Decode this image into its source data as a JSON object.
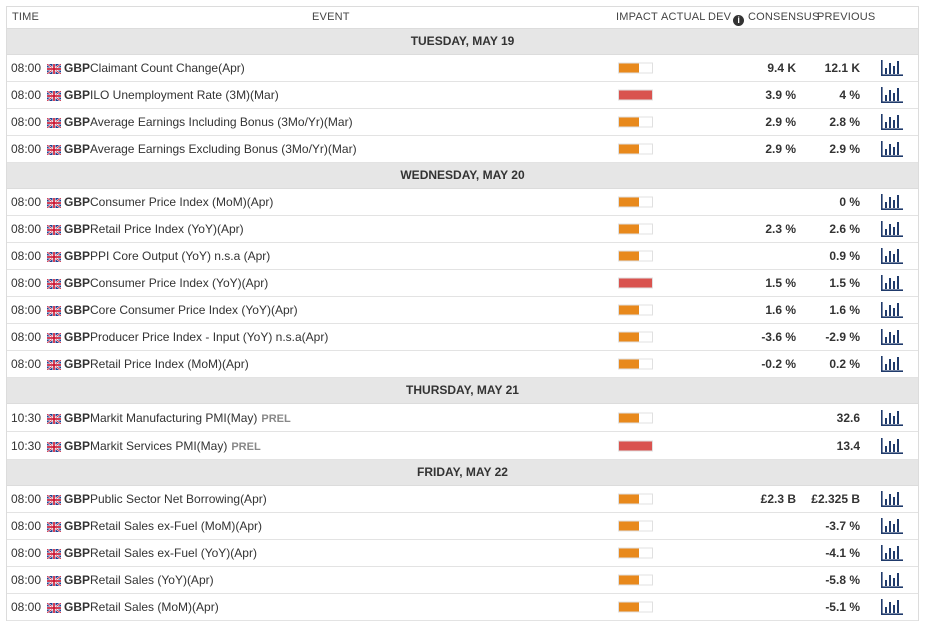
{
  "header": {
    "time": "Time",
    "event": "Event",
    "impact": "Impact",
    "actual": "Actual",
    "dev": "Dev",
    "consensus": "Consensus",
    "previous": "Previous"
  },
  "colors": {
    "medium": "#e8891c",
    "high": "#d9534f",
    "chart_icon": "#1f3a6b"
  },
  "days": [
    {
      "label": "Tuesday, May 19",
      "events": [
        {
          "time": "08:00",
          "currency": "GBP",
          "name": "Claimant Count Change(Apr)",
          "impact": "medium",
          "consensus": "9.4 K",
          "previous": "12.1 K"
        },
        {
          "time": "08:00",
          "currency": "GBP",
          "name": "ILO Unemployment Rate (3M)(Mar)",
          "impact": "high",
          "consensus": "3.9 %",
          "previous": "4 %"
        },
        {
          "time": "08:00",
          "currency": "GBP",
          "name": "Average Earnings Including Bonus (3Mo/Yr)(Mar)",
          "impact": "medium",
          "consensus": "2.9 %",
          "previous": "2.8 %"
        },
        {
          "time": "08:00",
          "currency": "GBP",
          "name": "Average Earnings Excluding Bonus (3Mo/Yr)(Mar)",
          "impact": "medium",
          "consensus": "2.9 %",
          "previous": "2.9 %"
        }
      ]
    },
    {
      "label": "Wednesday, May 20",
      "events": [
        {
          "time": "08:00",
          "currency": "GBP",
          "name": "Consumer Price Index (MoM)(Apr)",
          "impact": "medium",
          "consensus": "",
          "previous": "0 %"
        },
        {
          "time": "08:00",
          "currency": "GBP",
          "name": "Retail Price Index (YoY)(Apr)",
          "impact": "medium",
          "consensus": "2.3 %",
          "previous": "2.6 %"
        },
        {
          "time": "08:00",
          "currency": "GBP",
          "name": "PPI Core Output (YoY) n.s.a (Apr)",
          "impact": "medium",
          "consensus": "",
          "previous": "0.9 %"
        },
        {
          "time": "08:00",
          "currency": "GBP",
          "name": "Consumer Price Index (YoY)(Apr)",
          "impact": "high",
          "consensus": "1.5 %",
          "previous": "1.5 %"
        },
        {
          "time": "08:00",
          "currency": "GBP",
          "name": "Core Consumer Price Index (YoY)(Apr)",
          "impact": "medium",
          "consensus": "1.6 %",
          "previous": "1.6 %"
        },
        {
          "time": "08:00",
          "currency": "GBP",
          "name": "Producer Price Index - Input (YoY) n.s.a(Apr)",
          "impact": "medium",
          "consensus": "-3.6 %",
          "previous": "-2.9 %"
        },
        {
          "time": "08:00",
          "currency": "GBP",
          "name": "Retail Price Index (MoM)(Apr)",
          "impact": "medium",
          "consensus": "-0.2 %",
          "previous": "0.2 %"
        }
      ]
    },
    {
      "label": "Thursday, May 21",
      "events": [
        {
          "time": "10:30",
          "currency": "GBP",
          "name": "Markit Manufacturing PMI(May)",
          "tag": "PREL",
          "impact": "medium",
          "consensus": "",
          "previous": "32.6"
        },
        {
          "time": "10:30",
          "currency": "GBP",
          "name": "Markit Services PMI(May)",
          "tag": "PREL",
          "impact": "high",
          "consensus": "",
          "previous": "13.4"
        }
      ]
    },
    {
      "label": "Friday, May 22",
      "events": [
        {
          "time": "08:00",
          "currency": "GBP",
          "name": "Public Sector Net Borrowing(Apr)",
          "impact": "medium",
          "consensus": "£2.3 B",
          "previous": "£2.325 B"
        },
        {
          "time": "08:00",
          "currency": "GBP",
          "name": "Retail Sales ex-Fuel (MoM)(Apr)",
          "impact": "medium",
          "consensus": "",
          "previous": "-3.7 %"
        },
        {
          "time": "08:00",
          "currency": "GBP",
          "name": "Retail Sales ex-Fuel (YoY)(Apr)",
          "impact": "medium",
          "consensus": "",
          "previous": "-4.1 %"
        },
        {
          "time": "08:00",
          "currency": "GBP",
          "name": "Retail Sales (YoY)(Apr)",
          "impact": "medium",
          "consensus": "",
          "previous": "-5.8 %"
        },
        {
          "time": "08:00",
          "currency": "GBP",
          "name": "Retail Sales (MoM)(Apr)",
          "impact": "medium",
          "consensus": "",
          "previous": "-5.1 %"
        }
      ]
    }
  ]
}
